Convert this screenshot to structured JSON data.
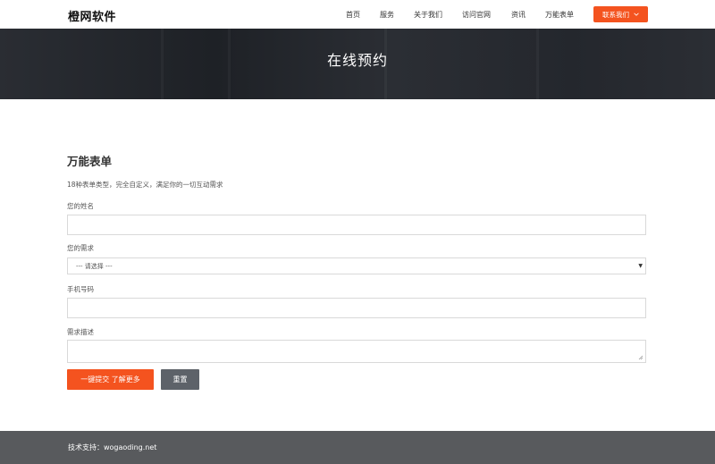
{
  "header": {
    "logo": "橙网软件",
    "nav": [
      "首页",
      "服务",
      "关于我们",
      "访问官网",
      "资讯",
      "万能表单"
    ],
    "contact_button": "联系我们"
  },
  "banner": {
    "title": "在线预约"
  },
  "form": {
    "title": "万能表单",
    "subtitle": "18种表单类型，完全自定义，满足你的一切互动需求",
    "name_label": "您的姓名",
    "name_value": "",
    "demand_label": "您的需求",
    "demand_selected": "--- 请选择 ---",
    "phone_label": "手机号码",
    "phone_value": "",
    "description_label": "需求描述",
    "description_value": "",
    "submit_label": "一键提交 了解更多",
    "reset_label": "重置"
  },
  "footer": {
    "text": "技术支持：wogaoding.net"
  },
  "colors": {
    "accent": "#f4531f",
    "banner": "#24272d",
    "footer": "#585a5d",
    "reset": "#5d6269"
  }
}
